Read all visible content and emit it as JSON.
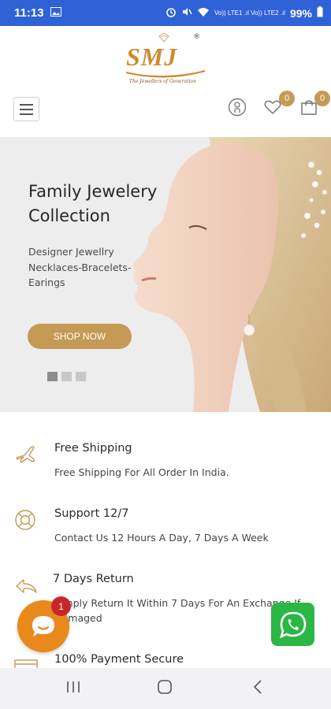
{
  "status_bar": {
    "time": "11:13",
    "battery": "99%",
    "network_label": "Vo)) LTE1 .ıl Vo)) LTE2 .ıl",
    "bg_color": "#2f62d6"
  },
  "header": {
    "logo_text": "SMJ",
    "logo_tagline": "The Jewellers of Generation",
    "logo_reg": "®",
    "wishlist_count": "0",
    "cart_count": "0",
    "accent_color": "#c49a55"
  },
  "hero": {
    "title_line1": "Family Jewelery",
    "title_line2": "Collection",
    "subtitle_line1": "Designer Jewellry",
    "subtitle_line2": "Necklaces-Bracelets-",
    "subtitle_line3": "Earings",
    "button_label": "SHOP NOW",
    "slide_count": 3,
    "active_slide": 1
  },
  "features": [
    {
      "icon": "airplane-icon",
      "title": "Free Shipping",
      "desc": "Free Shipping For All Order In India."
    },
    {
      "icon": "lifebuoy-icon",
      "title": "Support 12/7",
      "desc": "Contact Us 12 Hours A Day, 7 Days A Week"
    },
    {
      "icon": "return-arrow-icon",
      "title": "7 Days Return",
      "desc_line1": "Simply Return It Within 7 Days For An Exchange If",
      "desc_line2": "Damaged"
    },
    {
      "icon": "card-icon",
      "title": "100% Payment Secure"
    }
  ],
  "chat": {
    "badge_count": "1",
    "color": "#e8891c"
  },
  "whatsapp": {
    "color": "#2bb743"
  }
}
